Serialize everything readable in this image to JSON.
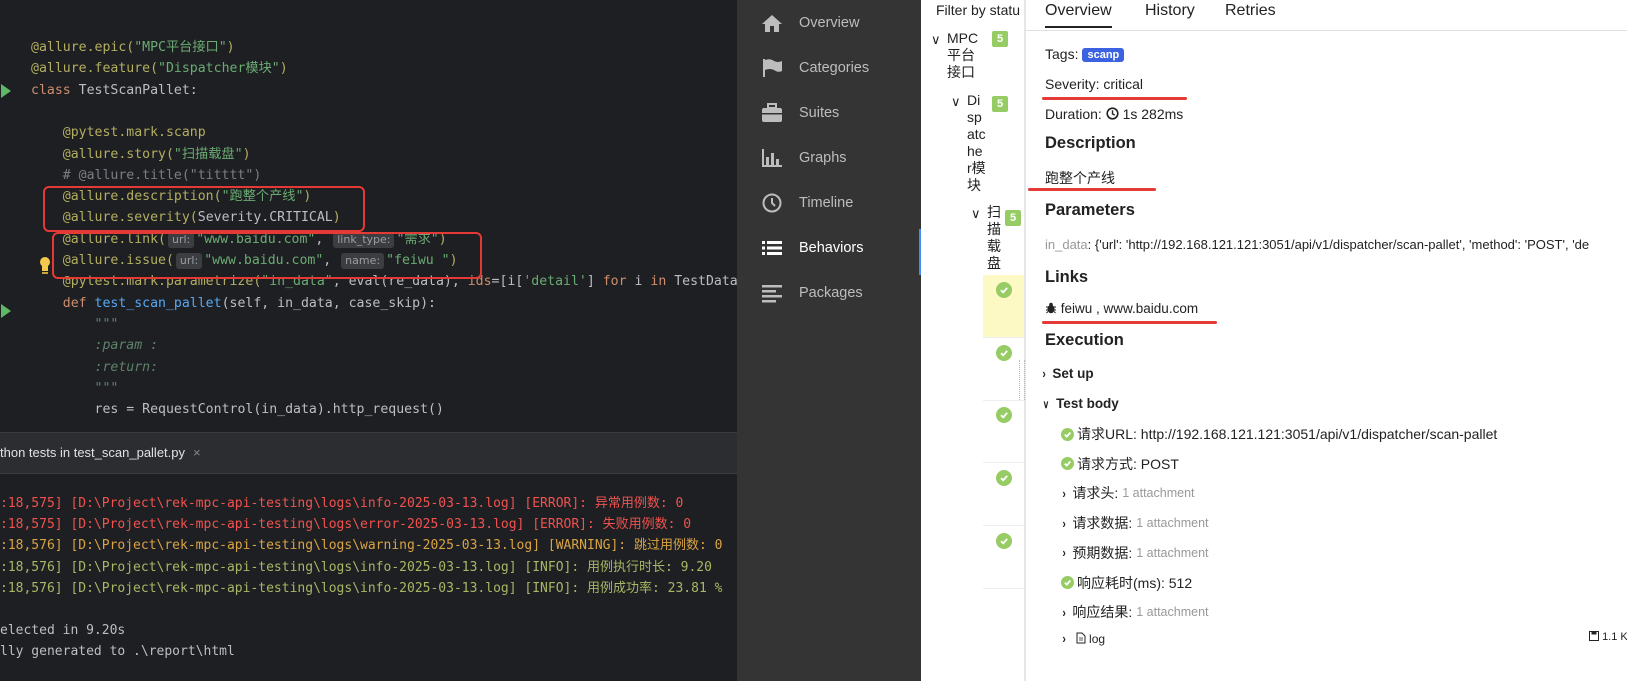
{
  "editor": {
    "lines": [
      {
        "code": [
          [
            "dec",
            "@allure.epic("
          ],
          [
            "str",
            "\"MPC平台接口\""
          ],
          [
            "dec",
            ")"
          ]
        ]
      },
      {
        "code": [
          [
            "dec",
            "@allure.feature("
          ],
          [
            "str",
            "\"Dispatcher模块\""
          ],
          [
            "dec",
            ")"
          ]
        ]
      },
      {
        "code": [
          [
            "kw",
            "class "
          ],
          [
            "",
            "TestScanPallet:"
          ]
        ]
      },
      {
        "code": []
      },
      {
        "code": [
          [
            "",
            "    "
          ],
          [
            "dec",
            "@pytest.mark.scanp"
          ]
        ]
      },
      {
        "code": [
          [
            "",
            "    "
          ],
          [
            "dec",
            "@allure.story("
          ],
          [
            "str",
            "\"扫描载盘\""
          ],
          [
            "dec",
            ")"
          ]
        ]
      },
      {
        "code": [
          [
            "",
            "    "
          ],
          [
            "cm",
            "# @allure.title(\"titttt\")"
          ]
        ]
      },
      {
        "code": [
          [
            "",
            "    "
          ],
          [
            "dec",
            "@allure.description("
          ],
          [
            "str",
            "\"跑整个产线\""
          ],
          [
            "dec",
            ")"
          ]
        ]
      },
      {
        "code": [
          [
            "",
            "    "
          ],
          [
            "dec",
            "@allure.severity("
          ],
          [
            "",
            "Severity.CRITICAL"
          ],
          [
            "dec",
            ")"
          ]
        ]
      },
      {
        "code": [
          [
            "",
            "    "
          ],
          [
            "dec",
            "@allure.link("
          ],
          [
            "hint",
            "url:"
          ],
          [
            "str",
            "\"www.baidu.com\""
          ],
          [
            "",
            ", "
          ],
          [
            "hint",
            "link_type:"
          ],
          [
            "str",
            "\"需求\""
          ],
          [
            "dec",
            ")"
          ]
        ]
      },
      {
        "code": [
          [
            "",
            "    "
          ],
          [
            "dec",
            "@allure.issue("
          ],
          [
            "hint",
            "url:"
          ],
          [
            "str",
            "\"www.baidu.com\""
          ],
          [
            "",
            ", "
          ],
          [
            "hint",
            "name:"
          ],
          [
            "str",
            "\"feiwu \""
          ],
          [
            "dec",
            ")"
          ]
        ]
      },
      {
        "code": [
          [
            "",
            "    "
          ],
          [
            "dec",
            "@pytest.mark.parametrize("
          ],
          [
            "str",
            "\"in_data\""
          ],
          [
            "",
            ", eval(re_data), "
          ],
          [
            "kw",
            "ids"
          ],
          [
            "",
            "=[i["
          ],
          [
            "str",
            "'detail'"
          ],
          [
            "",
            "] "
          ],
          [
            "kw",
            "for"
          ],
          [
            "",
            " i "
          ],
          [
            "kw",
            "in"
          ],
          [
            "",
            " TestData"
          ]
        ]
      },
      {
        "code": [
          [
            "",
            "    "
          ],
          [
            "kw",
            "def "
          ],
          [
            "fn",
            "test_scan_pallet"
          ],
          [
            "",
            "(self, in_data, case_skip):"
          ]
        ]
      },
      {
        "code": [
          [
            "",
            "        "
          ],
          [
            "dc",
            "\"\"\""
          ]
        ]
      },
      {
        "code": [
          [
            "",
            "        "
          ],
          [
            "dc",
            ":param :"
          ]
        ]
      },
      {
        "code": [
          [
            "",
            "        "
          ],
          [
            "dc",
            ":return:"
          ]
        ]
      },
      {
        "code": [
          [
            "",
            "        "
          ],
          [
            "dc",
            "\"\"\""
          ]
        ]
      },
      {
        "code": [
          [
            "",
            "        "
          ],
          [
            "",
            "res = RequestControl(in_data).http_request()"
          ]
        ]
      }
    ]
  },
  "run_panel": {
    "tab_label": "thon tests in test_scan_pallet.py",
    "close_glyph": "×"
  },
  "console": {
    "lines": [
      {
        "level": "err",
        "text": ":18,575] [D:\\Project\\rek-mpc-api-testing\\logs\\info-2025-03-13.log] [ERROR]: 异常用例数: 0"
      },
      {
        "level": "err",
        "text": ":18,575] [D:\\Project\\rek-mpc-api-testing\\logs\\error-2025-03-13.log] [ERROR]: 失败用例数: 0"
      },
      {
        "level": "warn",
        "text": ":18,576] [D:\\Project\\rek-mpc-api-testing\\logs\\warning-2025-03-13.log] [WARNING]: 跳过用例数: 0"
      },
      {
        "level": "info",
        "text": ":18,576] [D:\\Project\\rek-mpc-api-testing\\logs\\info-2025-03-13.log] [INFO]: 用例执行时长: 9.20"
      },
      {
        "level": "info",
        "text": ":18,576] [D:\\Project\\rek-mpc-api-testing\\logs\\info-2025-03-13.log] [INFO]: 用例成功率: 23.81 %"
      },
      {
        "level": "",
        "text": ""
      },
      {
        "level": "",
        "text": "elected in 9.20s"
      },
      {
        "level": "",
        "text": "lly generated to .\\report\\html"
      }
    ]
  },
  "nav": {
    "items": [
      {
        "label": "Overview",
        "icon": "home-icon"
      },
      {
        "label": "Categories",
        "icon": "flag-icon"
      },
      {
        "label": "Suites",
        "icon": "briefcase-icon"
      },
      {
        "label": "Graphs",
        "icon": "bar-chart-icon"
      },
      {
        "label": "Timeline",
        "icon": "clock-icon"
      },
      {
        "label": "Behaviors",
        "icon": "list-icon",
        "active": true
      },
      {
        "label": "Packages",
        "icon": "align-left-icon"
      }
    ]
  },
  "tree": {
    "filter_label": "Filter by statu",
    "nodes": [
      {
        "label": "MPC\n平台\n接口",
        "count": "5"
      },
      {
        "label": "Di\nsp\natc\nhe\nr模\n块",
        "count": "5"
      },
      {
        "label": "扫\n描\n载\n盘",
        "count": "5"
      }
    ],
    "result_count": 5
  },
  "detail": {
    "tabs": [
      "Overview",
      "History",
      "Retries"
    ],
    "tags_label": "Tags:",
    "tag": "scanp",
    "severity": "Severity: critical",
    "duration_label": "Duration:",
    "duration": "1s 282ms",
    "description_heading": "Description",
    "description": "跑整个产线",
    "parameters_heading": "Parameters",
    "param_name": "in_data",
    "param_value": ": {'url': 'http://192.168.121.121:3051/api/v1/dispatcher/scan-pallet', 'method': 'POST', 'de",
    "links_heading": "Links",
    "links_text": "feiwu , www.baidu.com",
    "execution_heading": "Execution",
    "setup_label": "Set up",
    "testbody_label": "Test body",
    "steps": [
      {
        "type": "check",
        "label": "请求URL: http://192.168.121.121:3051/api/v1/dispatcher/scan-pallet"
      },
      {
        "type": "check",
        "label": "请求方式: POST"
      },
      {
        "type": "attach",
        "label": "请求头:",
        "extra": "1 attachment"
      },
      {
        "type": "attach",
        "label": "请求数据:",
        "extra": "1 attachment"
      },
      {
        "type": "attach",
        "label": "预期数据:",
        "extra": "1 attachment"
      },
      {
        "type": "check",
        "label": "响应耗时(ms): 512"
      },
      {
        "type": "attach",
        "label": "响应结果:",
        "extra": "1 attachment"
      }
    ],
    "log_label": "log",
    "log_size": "1.1 K"
  },
  "colors": {
    "annotation_red": "#e53935",
    "passed": "#97cc64",
    "active_nav": "#3f8ff0"
  }
}
